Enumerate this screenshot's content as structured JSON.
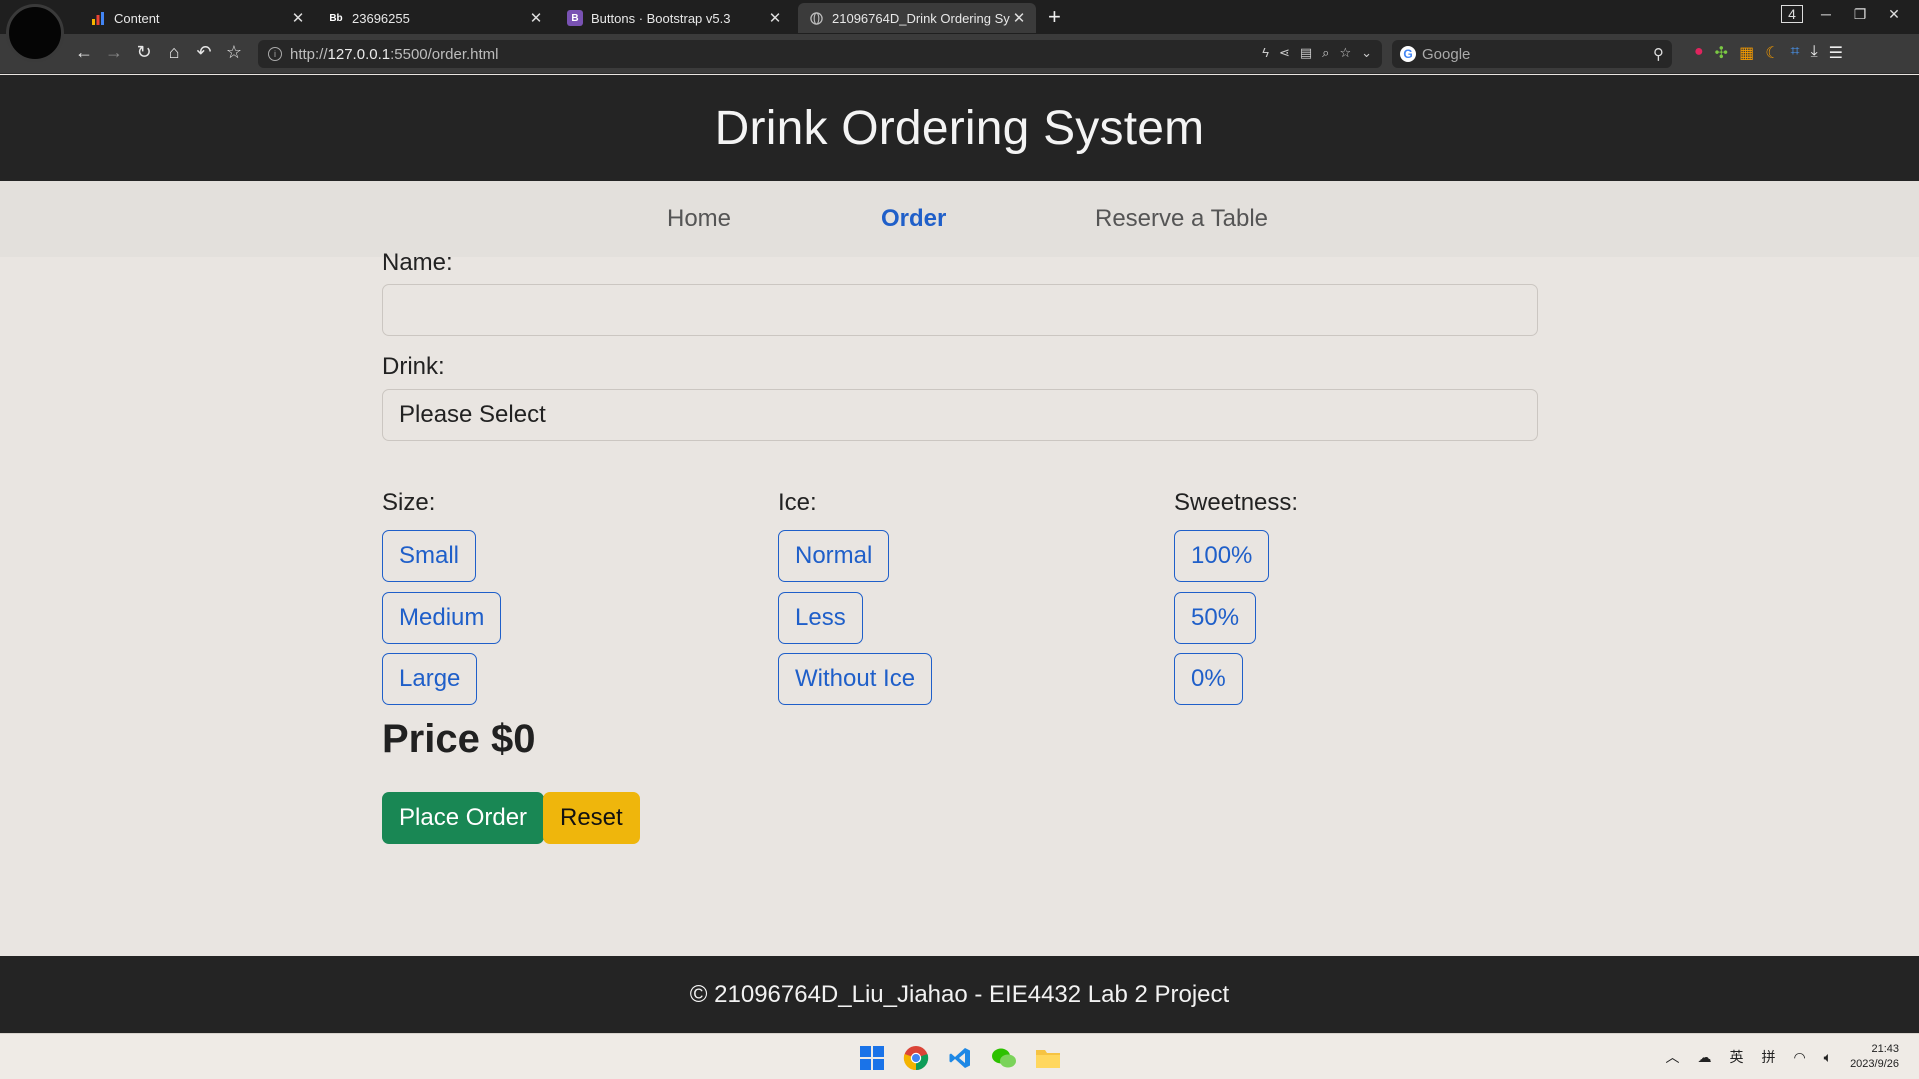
{
  "browser": {
    "tabs": [
      {
        "title": "Content",
        "favicon": "bar-chart-icon",
        "active": false
      },
      {
        "title": "23696255",
        "favicon": "Bb",
        "active": false
      },
      {
        "title": "Buttons · Bootstrap v5.3",
        "favicon": "B",
        "active": false
      },
      {
        "title": "21096764D_Drink Ordering Sy",
        "favicon": "globe-icon",
        "active": true
      }
    ],
    "tab_count": "4",
    "url_scheme": "http://",
    "url_host": "127.0.0.1",
    "url_path": ":5500/order.html",
    "search_placeholder": "Google"
  },
  "site": {
    "title": "Drink Ordering System",
    "nav": [
      {
        "label": "Home",
        "active": false
      },
      {
        "label": "Order",
        "active": true
      },
      {
        "label": "Reserve a Table",
        "active": false
      }
    ]
  },
  "form": {
    "name_label": "Name:",
    "name_value": "",
    "drink_label": "Drink:",
    "drink_selected": "Please Select",
    "size": {
      "label": "Size:",
      "options": [
        "Small",
        "Medium",
        "Large"
      ]
    },
    "ice": {
      "label": "Ice:",
      "options": [
        "Normal",
        "Less",
        "Without Ice"
      ]
    },
    "sweetness": {
      "label": "Sweetness:",
      "options": [
        "100%",
        "50%",
        "0%"
      ]
    },
    "price_text": "Price $0",
    "place_order_label": "Place Order",
    "reset_label": "Reset"
  },
  "footer": {
    "text": "© 21096764D_Liu_Jiahao - EIE4432 Lab 2 Project"
  },
  "taskbar": {
    "apps": [
      "windows-start-icon",
      "chrome-icon",
      "vscode-icon",
      "wechat-icon",
      "file-explorer-icon"
    ],
    "ime_lang": "英",
    "ime_mode": "拼",
    "time": "21:43",
    "date": "2023/9/26"
  },
  "colors": {
    "primary": "#1f5fc9",
    "success": "#198754",
    "warning": "#efb60c",
    "header_bg": "#242424",
    "page_bg": "#e9e5e1"
  }
}
